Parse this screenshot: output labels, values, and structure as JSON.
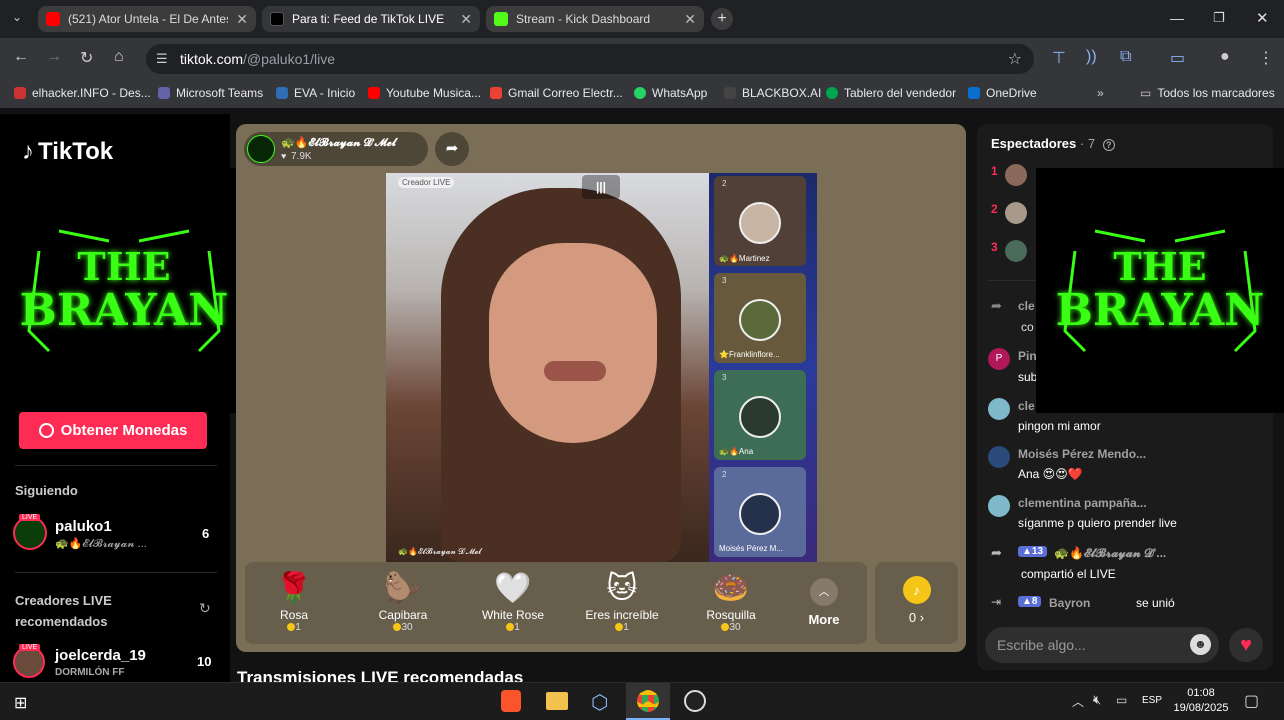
{
  "browser": {
    "tabs": [
      {
        "title": "(521) Ator Untela - El De Antes",
        "color": "#ff0000"
      },
      {
        "title": "Para ti: Feed de TikTok LIVE",
        "color": "#000000"
      },
      {
        "title": "Stream - Kick Dashboard",
        "color": "#53fc18"
      }
    ],
    "url_host": "tiktok.com",
    "url_path": "/@paluko1/live",
    "bookmarks": [
      {
        "label": "elhacker.INFO - Des...",
        "color": "#cc3333"
      },
      {
        "label": "Microsoft Teams",
        "color": "#6264a7"
      },
      {
        "label": "EVA - Inicio",
        "color": "#2f6db5"
      },
      {
        "label": "Youtube Musica...",
        "color": "#ff0000"
      },
      {
        "label": "Gmail Correo Electr...",
        "color": "#ea4335"
      },
      {
        "label": "WhatsApp",
        "color": "#25d366"
      },
      {
        "label": "BLACKBOX.AI",
        "color": "#444444"
      },
      {
        "label": "Tablero del vendedor",
        "color": "#00a650"
      },
      {
        "label": "OneDrive",
        "color": "#0a6ed1"
      }
    ],
    "all_bookmarks": "Todos los marcadores"
  },
  "sidebar": {
    "logo": "TikTok",
    "banner_text_1": "THE",
    "banner_text_2": "BRAYAN",
    "coins_button": "Obtener Monedas",
    "following_header": "Siguiendo",
    "following": [
      {
        "name": "paluko1",
        "sub": "🐢🔥𝓔𝓵𝓑𝓻𝓪𝔂𝓪𝓷 ...",
        "count": "6"
      }
    ],
    "recommended_header_1": "Creadores LIVE",
    "recommended_header_2": "recomendados",
    "recommended": [
      {
        "name": "joelcerda_19",
        "sub": "DORMILÓN FF",
        "count": "10"
      }
    ]
  },
  "stream": {
    "host_name": "🐢🔥𝓔𝓵𝓑𝓻𝓪𝔂𝓪𝓷 𝓓'𝓜𝓮𝓵",
    "host_likes": "7.9K",
    "video_label": "Creador LIVE",
    "watermark": "🐢🔥𝓔𝓵𝓑𝓻𝓪𝔂𝓪𝓷 𝓓'𝓜𝓮𝓵",
    "guests": [
      {
        "name": "🐢🔥Martinez",
        "badge": "2"
      },
      {
        "name": "⭐Franklinflore...",
        "badge": "3"
      },
      {
        "name": "🐢🔥Ana",
        "badge": "3"
      },
      {
        "name": "Moisés Pérez M...",
        "badge": "2"
      }
    ],
    "gifts": [
      {
        "name": "Rosa",
        "emoji": "🌹",
        "price": "1"
      },
      {
        "name": "Capibara",
        "emoji": "🦫",
        "price": "30"
      },
      {
        "name": "White Rose",
        "emoji": "🤍",
        "price": "1"
      },
      {
        "name": "Eres increíble",
        "emoji": "🐱",
        "price": "1"
      },
      {
        "name": "Rosquilla",
        "emoji": "🍩",
        "price": "30"
      }
    ],
    "more_label": "More",
    "coins_balance": "0 ›",
    "recommended_title": "Transmisiones LIVE recomendadas"
  },
  "chat": {
    "viewers_label": "Espectadores",
    "viewers_count": "· 7",
    "ranks": [
      "1",
      "2",
      "3"
    ],
    "messages": [
      {
        "name": "cle",
        "text": "co"
      },
      {
        "name": "Pin",
        "text": "sub"
      },
      {
        "name": "cle",
        "text": "pingon mi amor"
      },
      {
        "name": "Moisés Pérez Mendo...",
        "text": "Ana 😍😍❤️"
      },
      {
        "name": "clementina pampaña...",
        "text": "síganme p quiero prender live"
      }
    ],
    "share_badge": "13",
    "share_name": "🐢🔥𝓔𝓵𝓑𝓻𝓪𝔂𝓪𝓷 𝓓'...",
    "share_text": "compartió el LIVE",
    "join_badge": "8",
    "join_name": "Bayron",
    "join_text": "se unió",
    "input_placeholder": "Escribe algo..."
  },
  "taskbar": {
    "lang": "ESP",
    "time": "01:08",
    "date": "19/08/2025"
  },
  "colors": {
    "accent": "#fe2c55",
    "neon": "#39ff14"
  }
}
